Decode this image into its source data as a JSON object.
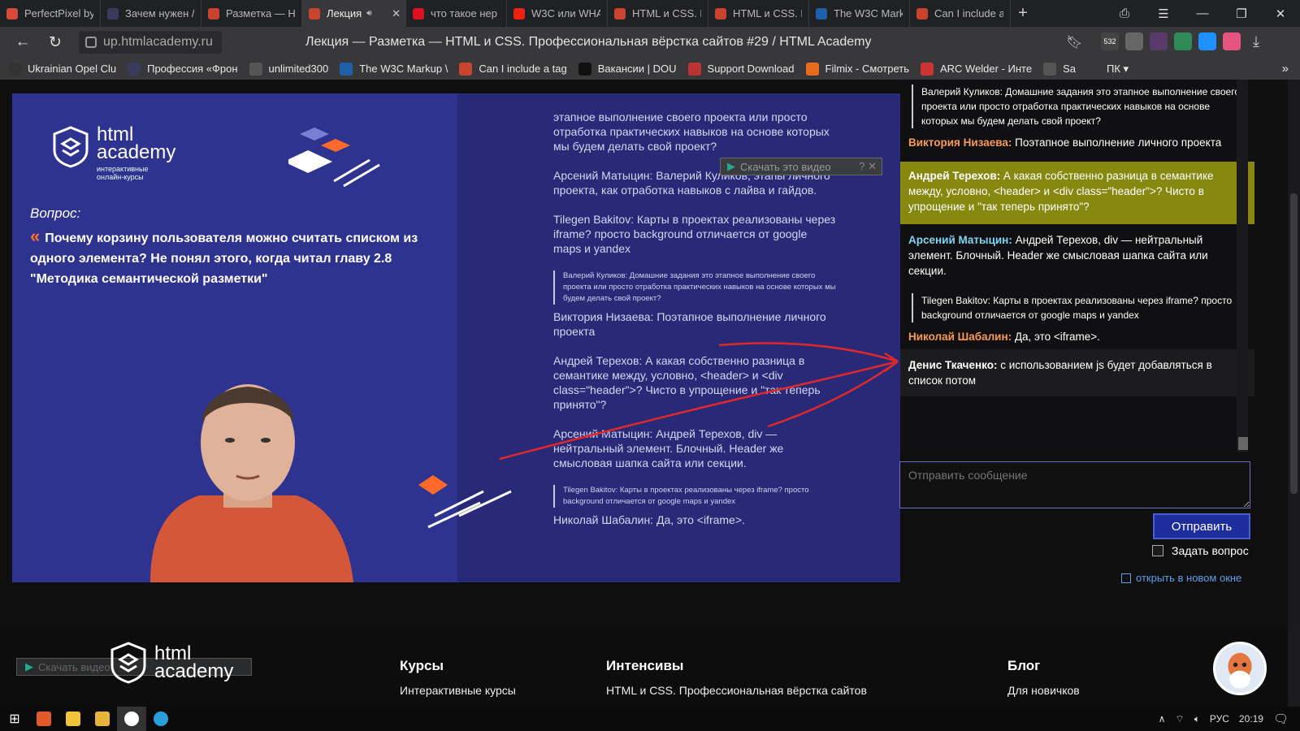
{
  "browser": {
    "tabs": [
      {
        "label": "PerfectPixel by",
        "icon_color": "#d64a3a",
        "active": false
      },
      {
        "label": "Зачем нужен /",
        "icon_color": "#3a3a5a",
        "active": false
      },
      {
        "label": "Разметка — H",
        "icon_color": "#c9442f",
        "active": false
      },
      {
        "label": "Лекция",
        "icon_color": "#c9442f",
        "active": true
      },
      {
        "label": "что такое нер",
        "icon_color": "#d12",
        "active": false
      },
      {
        "label": "W3C или WHA",
        "icon_color": "#e21",
        "active": false
      },
      {
        "label": "HTML и CSS. П",
        "icon_color": "#c9442f",
        "active": false
      },
      {
        "label": "HTML и CSS. П",
        "icon_color": "#c9442f",
        "active": false
      },
      {
        "label": "The W3C Mark",
        "icon_color": "#1d5fa8",
        "active": false
      },
      {
        "label": "Can I include a",
        "icon_color": "#c9442f",
        "active": false
      }
    ],
    "new_tab": "+",
    "url": "up.htmlacademy.ru",
    "page_title": "Лекция — Разметка — HTML и CSS. Профессиональная вёрстка сайтов #29 / HTML Academy",
    "ext_badge": "532",
    "bookmarks": [
      {
        "label": "Ukrainian Opel Clu",
        "color": "#333"
      },
      {
        "label": "Профессия «Фрон",
        "color": "#3a3a5a"
      },
      {
        "label": "unlimited300",
        "color": "#555"
      },
      {
        "label": "The W3C Markup \\",
        "color": "#1d5fa8"
      },
      {
        "label": "Can I include a tag",
        "color": "#c9442f"
      },
      {
        "label": "Вакансии | DOU",
        "color": "#111"
      },
      {
        "label": "Support Download",
        "color": "#b33"
      },
      {
        "label": "Filmix - Смотреть",
        "color": "#e86a1c"
      },
      {
        "label": "ARC Welder - Инте",
        "color": "#c33"
      },
      {
        "label": "Sa",
        "color": "#555"
      },
      {
        "label": "ПК ▾",
        "color": "#38383b"
      }
    ],
    "bookmarks_more": "»"
  },
  "video": {
    "download_label": "Скачать это видео",
    "logo_text_1": "html",
    "logo_text_2": "academy",
    "logo_sub_1": "интерактивные",
    "logo_sub_2": "онлайн-курсы",
    "question_label": "Вопрос:",
    "question_text": "Почему корзину пользователя можно считать списком из одного элемента? Не понял этого, когда читал главу 2.8 \"Методика семантической разметки\"",
    "slide_chat": [
      "этапное выполнение своего проекта или просто отработка практических навыков на основе которых мы будем делать свой проект?",
      "Арсений Матыцин: Валерий Куликов, этапы личного проекта, как отработка навыков с лайва и гайдов.",
      "Tilegen Bakitov: Карты в проектах реализованы через iframe? просто background отличается от google maps и yandex"
    ],
    "slide_quote_1": "Валерий Куликов: Домашние задания это этапное выполнение своего проекта или просто отработка практических навыков на основе которых мы будем делать свой проект?",
    "slide_chat_2": [
      "Виктория Низаева: Поэтапное выполнение личного проекта",
      "Андрей Терехов: А какая собственно разница в семантике между, условно, <header> и <div class=\"header\">? Чисто в упрощение и \"так теперь принято\"?",
      "Арсений Матыцин: Андрей Терехов, div — нейтральный элемент. Блочный. Header же смысловая шапка сайта или секции."
    ],
    "slide_quote_2": "Tilegen Bakitov: Карты в проектах реализованы через iframe? просто background отличается от google maps и yandex",
    "slide_chat_3": "Николай Шабалин: Да, это <iframe>."
  },
  "chat": {
    "messages": [
      {
        "quote": "Валерий Куликов: Домашние задания это этапное выполнение своего проекта или просто отработка практических навыков на основе которых мы будем делать свой проект?",
        "author": "Виктория Низаева:",
        "text": " Поэтапное выполнение личного проекта"
      },
      {
        "author": "Андрей Терехов:",
        "text": " А какая собственно разница в семантике между, условно, <header> и <div class=\"header\">? Чисто в упрощение и \"так теперь принято\"?"
      },
      {
        "author": "Арсений Матыцин:",
        "text": " Андрей Терехов, div — нейтральный элемент. Блочный. Header же смысловая шапка сайта или секции."
      },
      {
        "quote": "Tilegen Bakitov: Карты в проектах реализованы через iframe? просто background отличается от google maps и yandex",
        "author": "Николай Шабалин:",
        "text": " Да, это <iframe>."
      },
      {
        "author": "Денис Ткаченко:",
        "text": " с использованием js будет добавляться в список потом"
      }
    ],
    "input_placeholder": "Отправить сообщение",
    "send_label": "Отправить",
    "ask_label": "Задать вопрос",
    "open_link": "открыть в новом окне"
  },
  "footer": {
    "logo_1": "html",
    "logo_2": "academy",
    "download_label": "Скачать видео",
    "columns": [
      {
        "title": "Курсы",
        "item": "Интерактивные курсы"
      },
      {
        "title": "Интенсивы",
        "item": "HTML и CSS. Профессиональная вёрстка сайтов"
      },
      {
        "title": "Блог",
        "item": "Для новичков"
      }
    ]
  },
  "taskbar": {
    "lang": "РУС",
    "time": "20:19"
  }
}
